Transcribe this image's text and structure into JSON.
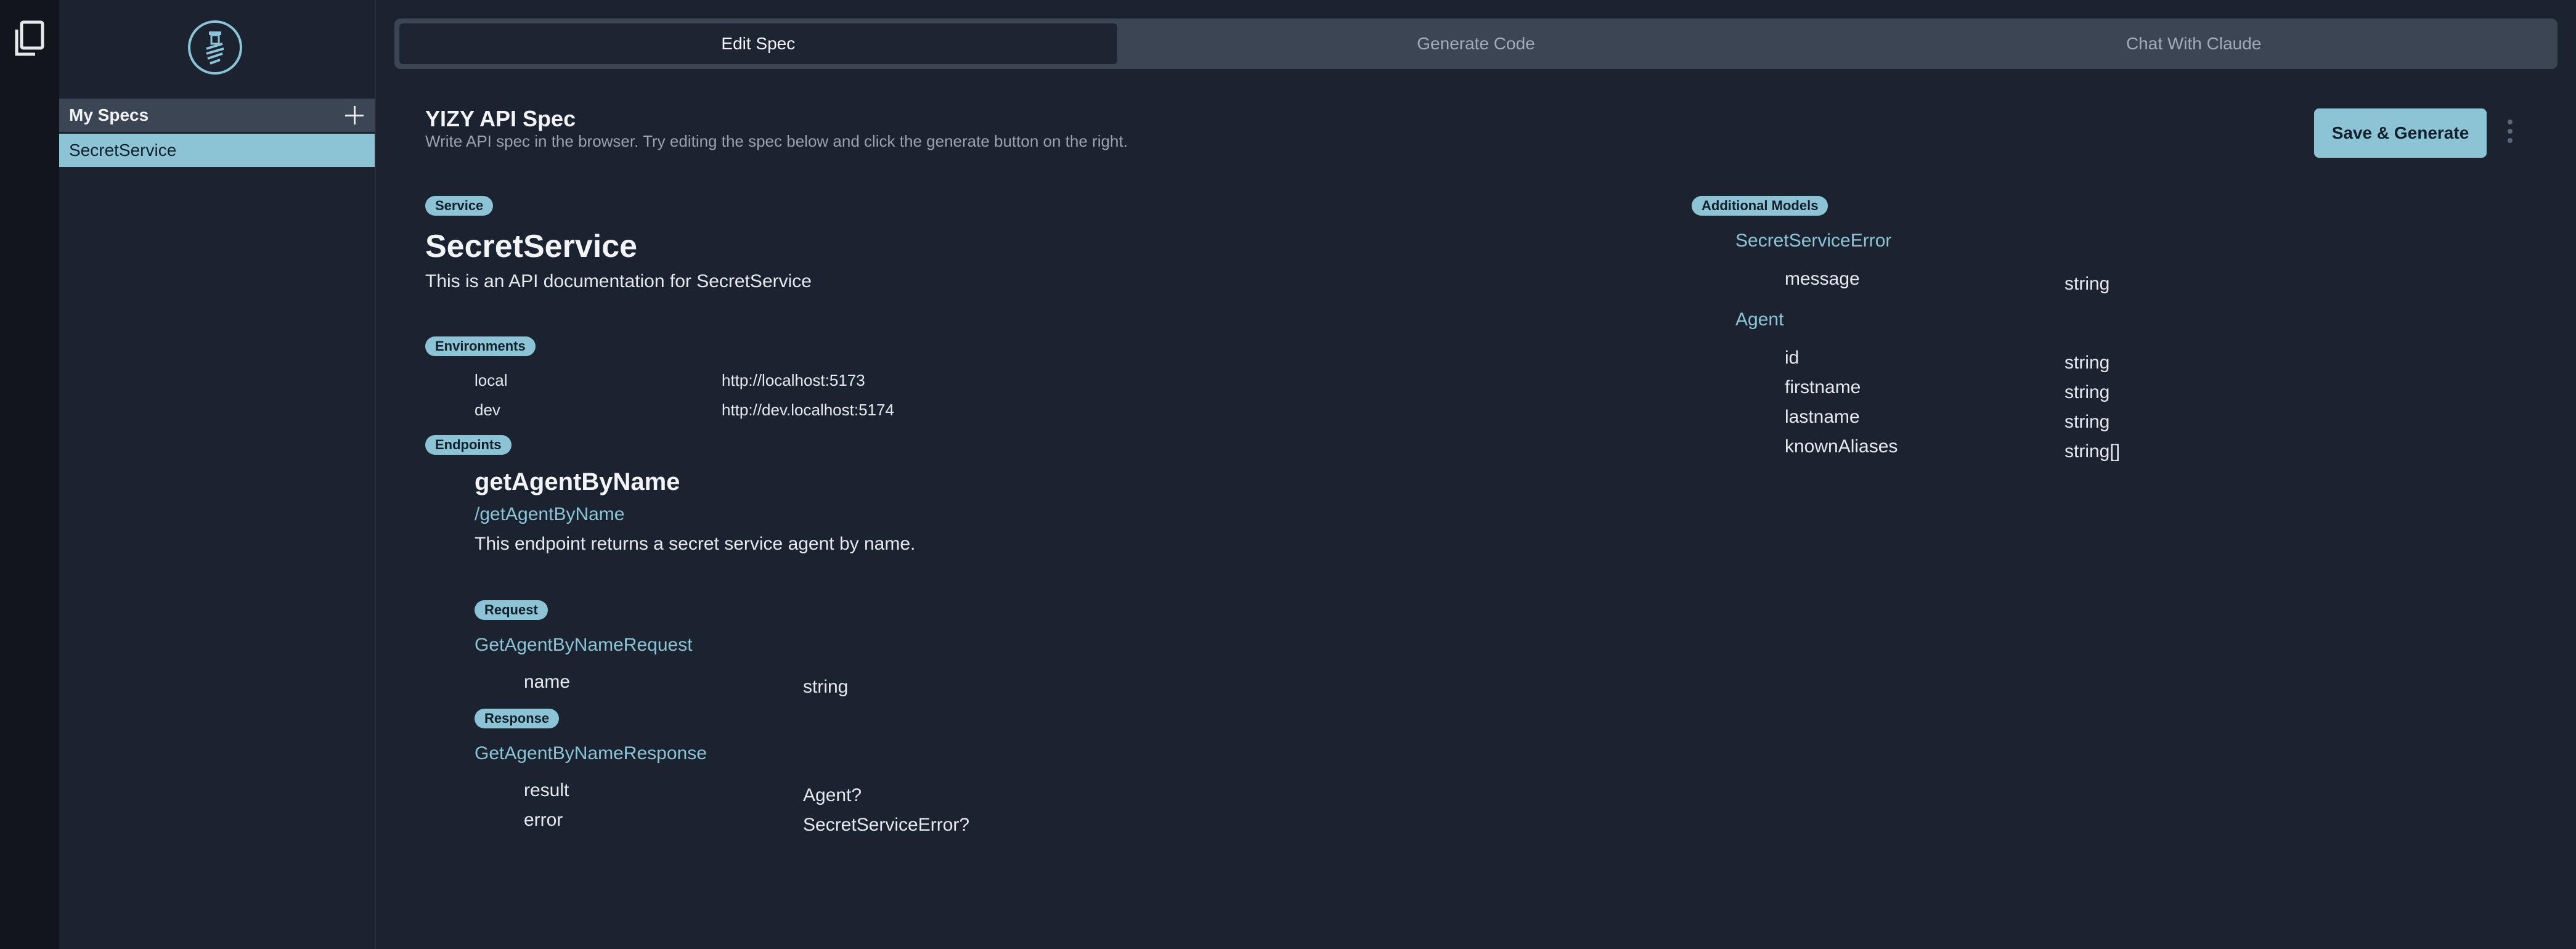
{
  "sidebar": {
    "heading": "My Specs",
    "items": [
      {
        "label": "SecretService"
      }
    ]
  },
  "tabs": [
    {
      "label": "Edit Spec",
      "active": true
    },
    {
      "label": "Generate Code",
      "active": false
    },
    {
      "label": "Chat With Claude",
      "active": false
    }
  ],
  "header": {
    "title": "YIZY API Spec",
    "subtitle": "Write API spec in the browser. Try editing the spec below and click the generate button on the right.",
    "save_label": "Save & Generate"
  },
  "service": {
    "badge": "Service",
    "name": "SecretService",
    "description": "This is an API documentation for SecretService"
  },
  "environments": {
    "badge": "Environments",
    "items": [
      {
        "name": "local",
        "url": "http://localhost:5173"
      },
      {
        "name": "dev",
        "url": "http://dev.localhost:5174"
      }
    ]
  },
  "endpoints": {
    "badge": "Endpoints",
    "items": [
      {
        "name": "getAgentByName",
        "path": "/getAgentByName",
        "description": "This endpoint returns a secret service agent by name.",
        "request": {
          "badge": "Request",
          "model": "GetAgentByNameRequest",
          "fields": [
            {
              "name": "name",
              "type": "string"
            }
          ]
        },
        "response": {
          "badge": "Response",
          "model": "GetAgentByNameResponse",
          "fields": [
            {
              "name": "result",
              "type": "Agent?"
            },
            {
              "name": "error",
              "type": "SecretServiceError?"
            }
          ]
        }
      }
    ]
  },
  "additional_models": {
    "badge": "Additional Models",
    "models": [
      {
        "name": "SecretServiceError",
        "fields": [
          {
            "name": "message",
            "type": "string"
          }
        ]
      },
      {
        "name": "Agent",
        "fields": [
          {
            "name": "id",
            "type": "string"
          },
          {
            "name": "firstname",
            "type": "string"
          },
          {
            "name": "lastname",
            "type": "string"
          },
          {
            "name": "knownAliases",
            "type": "string[]"
          }
        ]
      }
    ]
  },
  "colors": {
    "accent": "#8cc4d6",
    "background": "#1b2230",
    "panel": "#3c4554",
    "rail": "#12151c"
  }
}
